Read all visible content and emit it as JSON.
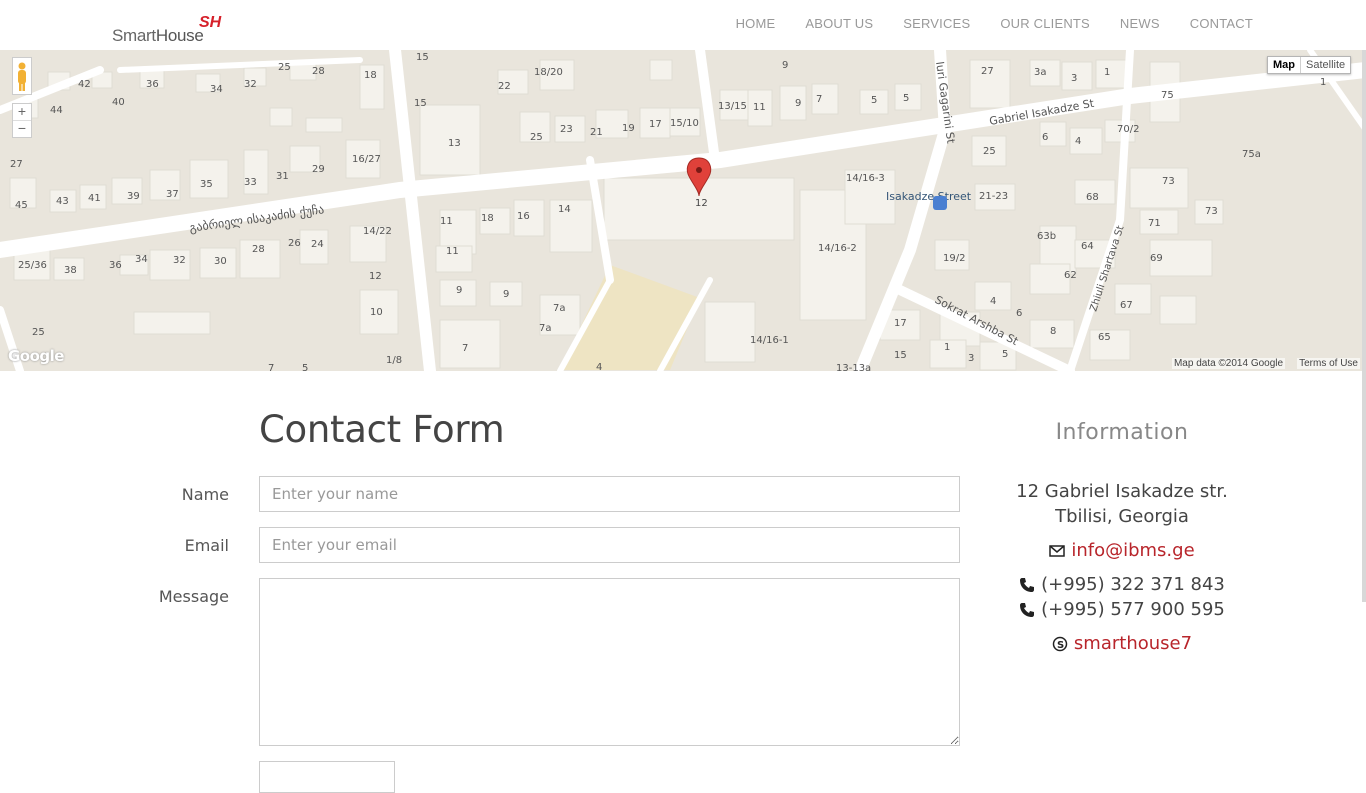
{
  "header": {
    "logo_text_light": "Smart",
    "logo_text_bold": "House",
    "logo_mark": "SH",
    "nav": [
      {
        "label": "HOME"
      },
      {
        "label": "ABOUT US"
      },
      {
        "label": "SERVICES"
      },
      {
        "label": "OUR CLIENTS"
      },
      {
        "label": "NEWS"
      },
      {
        "label": "CONTACT"
      }
    ]
  },
  "map": {
    "type_map": "Map",
    "type_satellite": "Satellite",
    "zoom_in": "+",
    "zoom_out": "−",
    "attribution": "Map data ©2014 Google",
    "terms": "Terms of Use",
    "provider_logo": "Google",
    "street_main_georgian": "გაბრიელ ისაკაძის ქუჩა",
    "street_isakadze": "Gabriel Isakadze St",
    "street_gagarini": "Iuri Gagarini St",
    "street_arshba": "Sokrat Arshba St",
    "street_shartava": "Zhiuli Shartava St",
    "bus_stop": "Isakadze Street",
    "marker_label": "12"
  },
  "contact_form": {
    "title": "Contact Form",
    "name_label": "Name",
    "name_placeholder": "Enter your name",
    "email_label": "Email",
    "email_placeholder": "Enter your email",
    "message_label": "Message"
  },
  "information": {
    "title": "Information",
    "address_line1": "12 Gabriel Isakadze str.",
    "address_line2": "Tbilisi, Georgia",
    "email": "info@ibms.ge",
    "phone1": "(+995) 322 371 843",
    "phone2": "(+995) 577 900 595",
    "skype": "smarthouse7"
  },
  "colors": {
    "accent": "#b8252b",
    "map_bg": "#e9e5dc",
    "building": "#f3f1eb",
    "road": "#ffffff"
  }
}
